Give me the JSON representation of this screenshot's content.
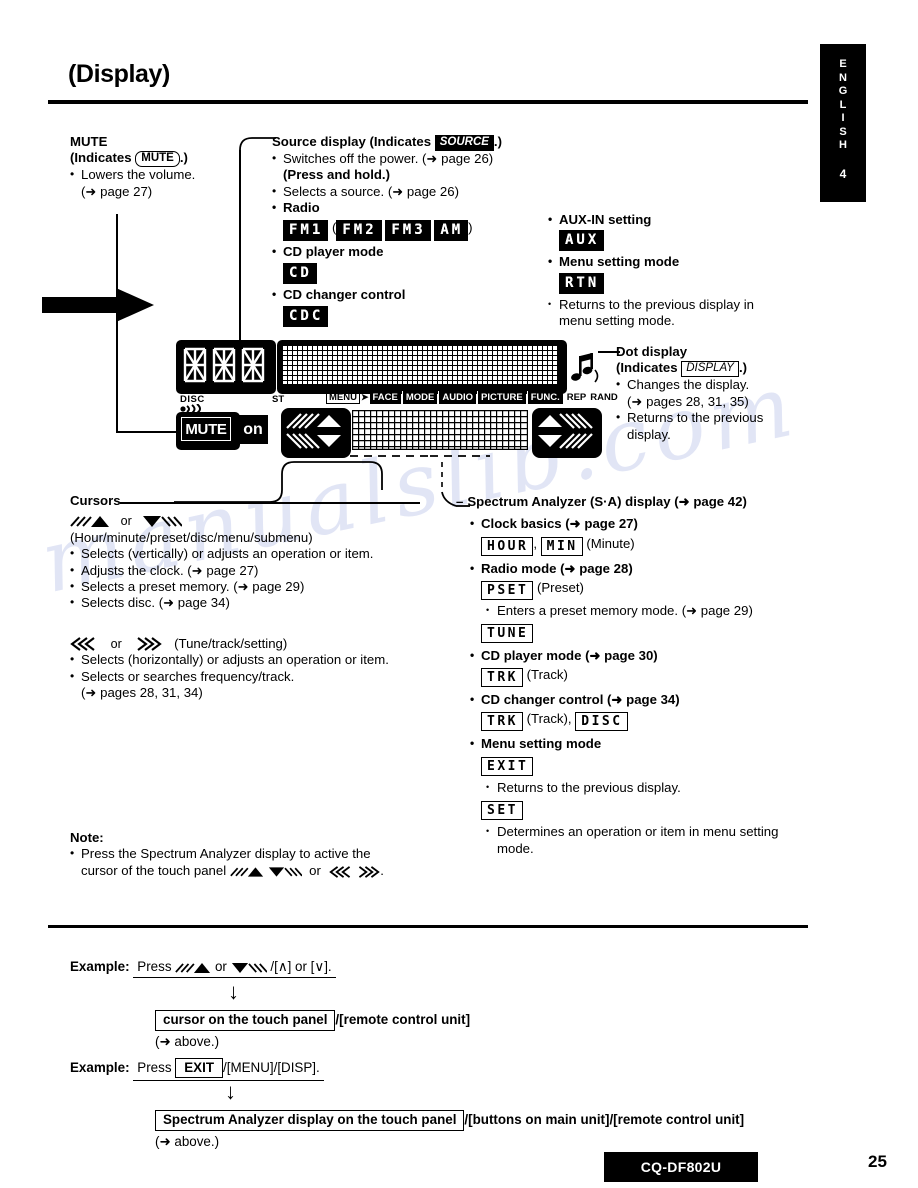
{
  "lang_tab": {
    "letters": "ENGLISH",
    "number": "4"
  },
  "page_title": "(Display)",
  "mute": {
    "heading": "MUTE",
    "indicates_prefix": "(Indicates",
    "indicates_cap": "MUTE",
    "indicates_suffix": ".)",
    "bullet1": "Lowers the volume.",
    "bullet1_ref": "(➜ page 27)"
  },
  "source_display": {
    "heading": "Source display (Indicates",
    "heading_cap": "SOURCE",
    "heading_suffix": ".)",
    "b1": "Switches off the power. (➜ page 26)",
    "b1_sub": "(Press and hold.)",
    "b2": "Selects a source. (➜ page 26)",
    "b3": "Radio",
    "radio_segs": [
      "FM1",
      "FM2",
      "FM3",
      "AM"
    ],
    "radio_paren_open": "(",
    "radio_paren_close": ")",
    "b4": "CD player mode",
    "cd_seg": "CD",
    "b5": "CD changer control",
    "cdc_seg": "CDC"
  },
  "aux": {
    "b1": "AUX-IN setting",
    "aux_seg": "AUX",
    "b2": "Menu setting mode",
    "rtn_seg": "RTN",
    "b2_sub": "Returns to the previous display in menu setting mode."
  },
  "dot_display": {
    "heading": "Dot display",
    "indicates_prefix": "(Indicates",
    "indicates_cap": "DISPLAY",
    "indicates_suffix": ".)",
    "b1": "Changes the display.",
    "b1_ref": "(➜ pages 28, 31, 35)",
    "b2": "Returns to the previous display."
  },
  "lcd_panel": {
    "label_disc": "DISC",
    "label_st": "ST",
    "label_menu": "MENU",
    "indicators": [
      "FACE",
      "MODE",
      "AUDIO",
      "PICTURE",
      "FUNC."
    ],
    "label_rep": "REP",
    "label_rand": "RAND",
    "label_mute": "MUTE",
    "label_on": "on"
  },
  "cursors": {
    "heading": "Cursors",
    "row1_or": "or",
    "row1_desc": "(Hour/minute/preset/disc/menu/submenu)",
    "b1": "Selects (vertically) or adjusts an operation or item.",
    "b2": "Adjusts the clock. (➜ page 27)",
    "b3": "Selects a preset memory. (➜ page 29)",
    "b4": "Selects disc. (➜ page 34)",
    "row2_or": "or",
    "row2_desc": "(Tune/track/setting)",
    "b5": "Selects (horizontally) or adjusts an operation or item.",
    "b6": "Selects or searches frequency/track.",
    "b6_ref": "(➜ pages 28, 31, 34)"
  },
  "note": {
    "heading": "Note:",
    "text_a": "Press the Spectrum Analyzer display to active the",
    "text_b": "cursor of the touch panel",
    "text_or": "or",
    "text_end": "."
  },
  "spectrum": {
    "heading": "Spectrum Analyzer (S·A) display (➜ page 42)",
    "g1_title": "Clock basics (➜ page 27)",
    "g1_seg1": "HOUR",
    "g1_comma": ",",
    "g1_seg2": "MIN",
    "g1_note": "(Minute)",
    "g2_title": "Radio mode (➜ page 28)",
    "g2_seg1": "PSET",
    "g2_note": "(Preset)",
    "g2_sub": "Enters a preset memory mode. (➜ page 29)",
    "g2_seg2": "TUNE",
    "g3_title": "CD player mode (➜ page 30)",
    "g3_seg1": "TRK",
    "g3_note": "(Track)",
    "g4_title": "CD changer control (➜ page 34)",
    "g4_seg1": "TRK",
    "g4_note": "(Track),",
    "g4_seg2": "DISC",
    "g5_title": "Menu setting mode",
    "g5_seg1": "EXIT",
    "g5_sub": "Returns to the previous display.",
    "g5_seg2": "SET",
    "g5_sub2": "Determines an operation or item in menu setting mode."
  },
  "examples": {
    "ex1_label": "Example:",
    "ex1_press": "Press",
    "ex1_or": "or",
    "ex1_tail": "/[∧] or [∨].",
    "ex1_result_box": "cursor on the touch panel",
    "ex1_result_tail": "/[remote control unit]",
    "ex1_ref": "(➜ above.)",
    "ex2_label": "Example:",
    "ex2_press": "Press",
    "ex2_box": "EXIT",
    "ex2_tail": "/[MENU]/[DISP].",
    "ex2_result_box": "Spectrum Analyzer display on the touch panel",
    "ex2_result_tail": "/[buttons on main unit]/[remote control unit]",
    "ex2_ref": "(➜ above.)"
  },
  "footer": {
    "model": "CQ-DF802U",
    "page_number": "25"
  },
  "watermark": "manualslib.com"
}
